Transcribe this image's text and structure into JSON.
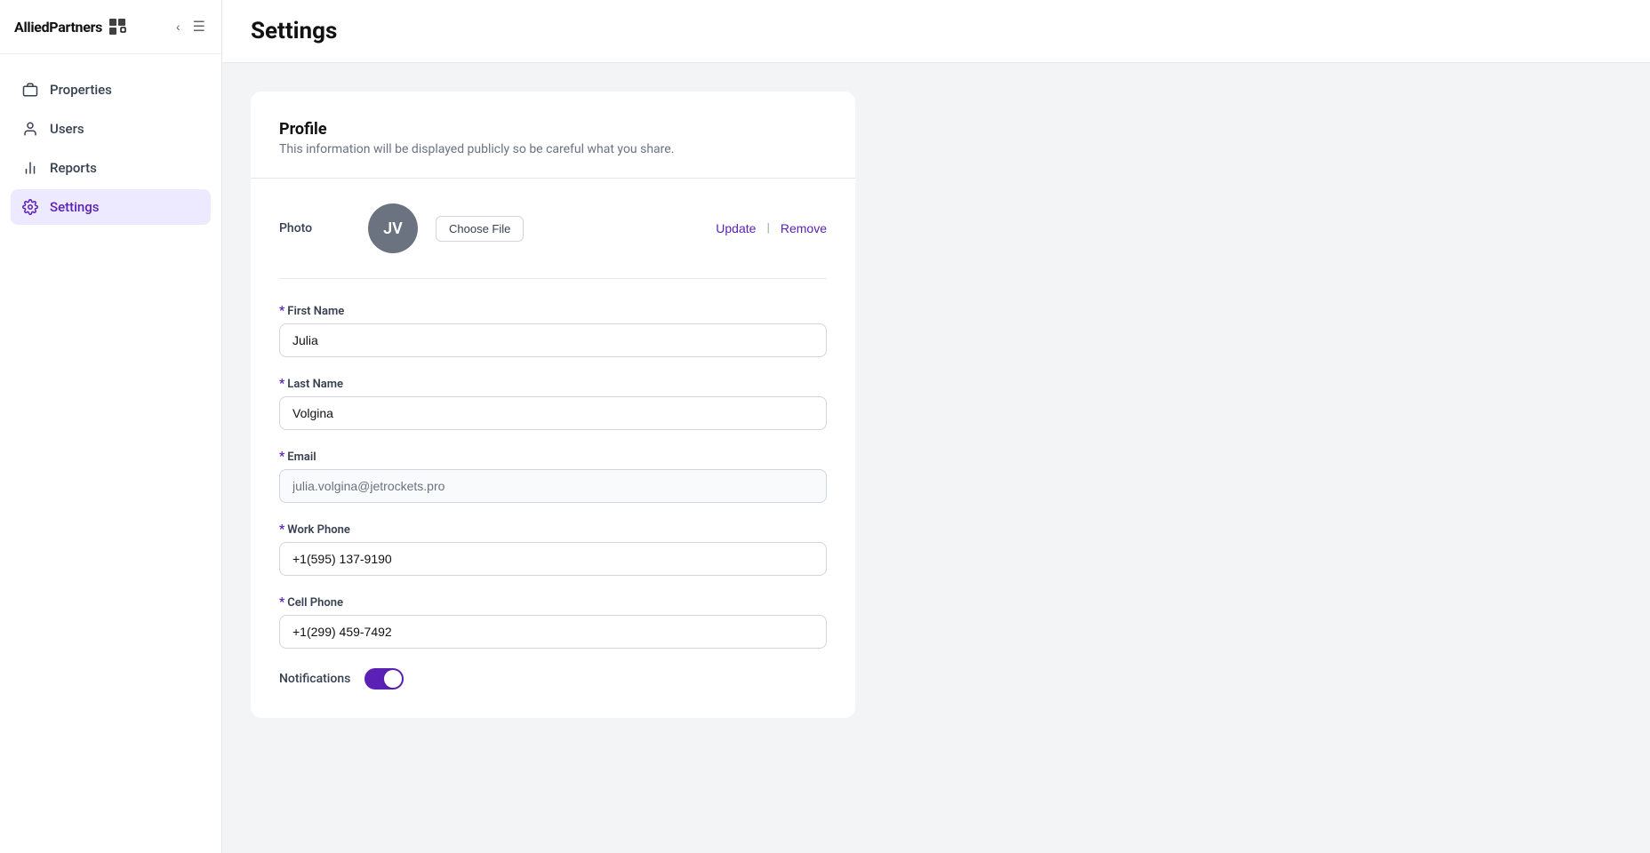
{
  "app": {
    "name": "AlliedPartners",
    "logo_icon": "⊞"
  },
  "sidebar": {
    "items": [
      {
        "id": "properties",
        "label": "Properties",
        "icon": "briefcase",
        "active": false
      },
      {
        "id": "users",
        "label": "Users",
        "icon": "user",
        "active": false
      },
      {
        "id": "reports",
        "label": "Reports",
        "icon": "bar-chart",
        "active": false
      },
      {
        "id": "settings",
        "label": "Settings",
        "icon": "gear",
        "active": true
      }
    ]
  },
  "page": {
    "title": "Settings"
  },
  "profile": {
    "section_title": "Profile",
    "section_subtitle": "This information will be displayed publicly so be careful what you share.",
    "photo_label": "Photo",
    "avatar_initials": "JV",
    "choose_file_label": "Choose File",
    "update_label": "Update",
    "remove_label": "Remove",
    "fields": {
      "first_name": {
        "label": "First Name",
        "value": "Julia",
        "required": true
      },
      "last_name": {
        "label": "Last Name",
        "value": "Volgina",
        "required": true
      },
      "email": {
        "label": "Email",
        "value": "julia.volgina@jetrockets.pro",
        "required": true,
        "readonly": true
      },
      "work_phone": {
        "label": "Work Phone",
        "value": "+1(595) 137-9190",
        "required": true
      },
      "cell_phone": {
        "label": "Cell Phone",
        "value": "+1(299) 459-7492",
        "required": true
      }
    },
    "notifications_label": "Notifications",
    "notifications_enabled": true
  }
}
